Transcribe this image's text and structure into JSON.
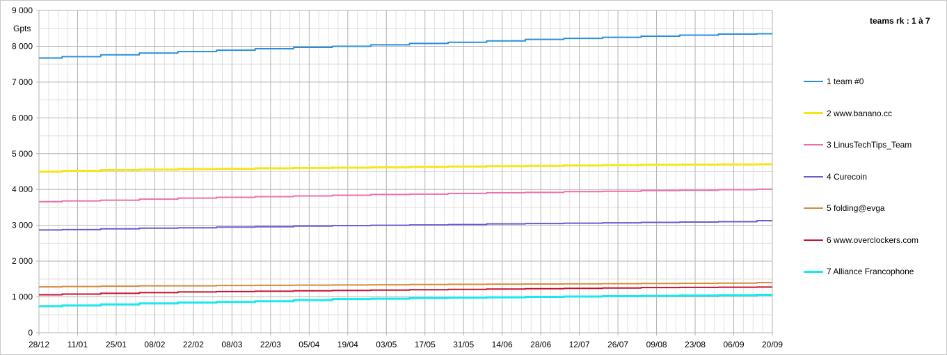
{
  "chart_data": {
    "type": "line",
    "title": "",
    "ylabel": "Gpts",
    "xlabel": "",
    "ylim": [
      0,
      9000
    ],
    "grid": true,
    "legend_title": "teams rk : 1 à 7",
    "legend_position": "right",
    "y_ticks": [
      "0",
      "1 000",
      "2 000",
      "3 000",
      "4 000",
      "5 000",
      "6 000",
      "7 000",
      "8 000",
      "9 000"
    ],
    "x_ticks": [
      "28/12",
      "11/01",
      "25/01",
      "08/02",
      "22/02",
      "08/03",
      "22/03",
      "05/04",
      "19/04",
      "03/05",
      "17/05",
      "31/05",
      "14/06",
      "28/06",
      "12/07",
      "26/07",
      "09/08",
      "23/08",
      "06/09",
      "20/09"
    ],
    "series": [
      {
        "name": "1 team #0",
        "color": "#2a8fd8",
        "values": [
          7670,
          7710,
          7760,
          7810,
          7850,
          7890,
          7930,
          7970,
          8000,
          8040,
          8080,
          8110,
          8150,
          8190,
          8220,
          8250,
          8280,
          8310,
          8340,
          8350
        ]
      },
      {
        "name": "2 www.banano.cc",
        "color": "#f5e61c",
        "values": [
          4500,
          4520,
          4540,
          4555,
          4570,
          4580,
          4590,
          4600,
          4610,
          4620,
          4630,
          4640,
          4650,
          4660,
          4670,
          4680,
          4690,
          4695,
          4700,
          4705
        ]
      },
      {
        "name": "3 LinusTechTips_Team",
        "color": "#ee6fa8",
        "values": [
          3660,
          3680,
          3700,
          3730,
          3760,
          3780,
          3800,
          3820,
          3840,
          3860,
          3870,
          3890,
          3910,
          3920,
          3940,
          3950,
          3970,
          3980,
          3995,
          4010
        ]
      },
      {
        "name": "4 Curecoin",
        "color": "#6b5acd",
        "values": [
          2870,
          2880,
          2900,
          2920,
          2930,
          2950,
          2960,
          2980,
          2990,
          3000,
          3010,
          3020,
          3040,
          3050,
          3060,
          3070,
          3080,
          3090,
          3100,
          3130
        ]
      },
      {
        "name": "5 folding@evga",
        "color": "#d58a3a",
        "values": [
          1280,
          1290,
          1300,
          1310,
          1310,
          1320,
          1325,
          1330,
          1335,
          1340,
          1345,
          1350,
          1355,
          1360,
          1365,
          1370,
          1375,
          1380,
          1385,
          1400
        ]
      },
      {
        "name": "6 www.overclockers.com",
        "color": "#c8102e",
        "values": [
          1060,
          1080,
          1100,
          1120,
          1140,
          1150,
          1160,
          1170,
          1180,
          1190,
          1200,
          1210,
          1220,
          1230,
          1240,
          1250,
          1260,
          1265,
          1270,
          1275
        ]
      },
      {
        "name": "7 Alliance Francophone",
        "color": "#19e8ee",
        "values": [
          740,
          760,
          790,
          820,
          840,
          860,
          880,
          910,
          940,
          950,
          970,
          980,
          990,
          1000,
          1010,
          1020,
          1030,
          1040,
          1050,
          1060
        ]
      }
    ]
  }
}
